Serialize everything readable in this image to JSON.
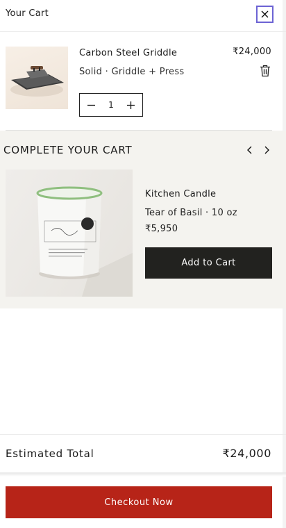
{
  "header": {
    "title": "Your Cart"
  },
  "cart_item": {
    "name": "Carbon Steel Griddle",
    "variant": "Solid · Griddle + Press",
    "price": "₹24,000",
    "quantity": "1"
  },
  "upsell": {
    "title": "COMPLETE YOUR CART",
    "product": {
      "name": "Kitchen Candle",
      "variant": "Tear of Basil · 10 oz",
      "price": "₹5,950",
      "add_label": "Add to Cart"
    }
  },
  "summary": {
    "total_label": "Estimated Total",
    "total_value": "₹24,000"
  },
  "checkout": {
    "label": "Checkout Now"
  },
  "colors": {
    "checkout": "#b72418",
    "add_button": "#22221f",
    "close_focus": "#6c63d4",
    "upsell_bg": "#f4f3ef"
  },
  "icons": [
    "close-icon",
    "trash-icon",
    "minus-icon",
    "plus-icon",
    "chevron-left-icon",
    "chevron-right-icon"
  ]
}
